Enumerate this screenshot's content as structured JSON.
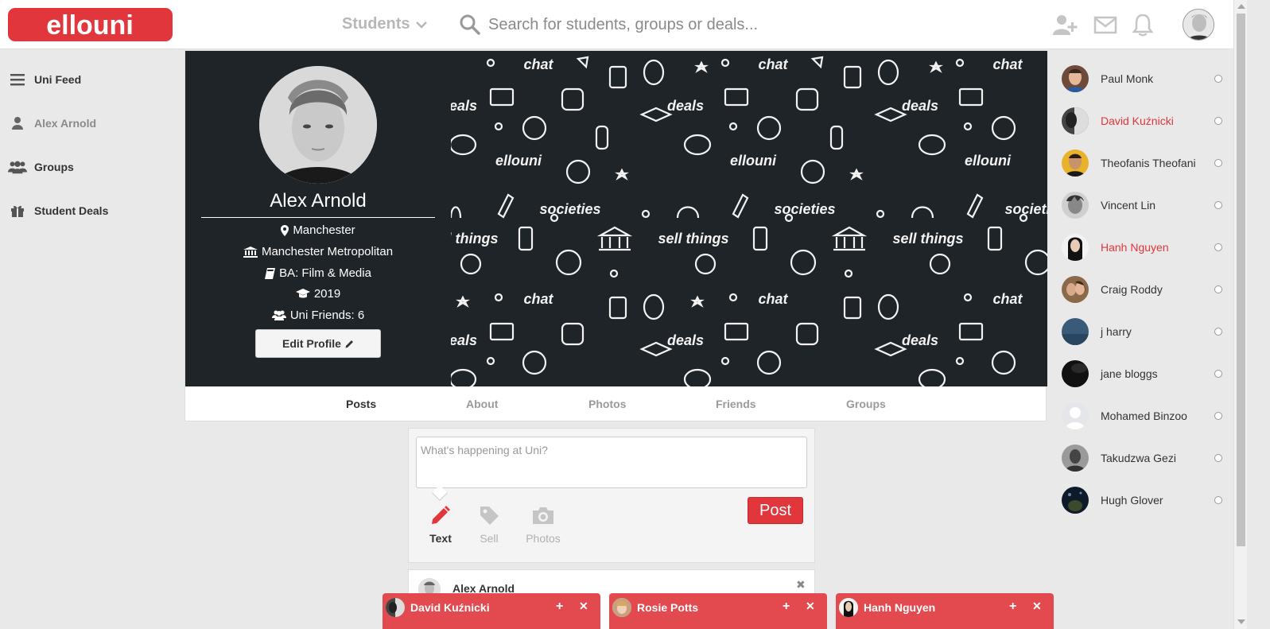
{
  "brand": {
    "accent": "#e0363c",
    "logo_text": "ellouni"
  },
  "topbar": {
    "scope_label": "Students",
    "search_placeholder": "Search for students, groups or deals...",
    "icons": [
      "add-friend-icon",
      "envelope-icon",
      "bell-icon"
    ]
  },
  "leftnav": {
    "items": [
      {
        "label": "Uni Feed",
        "icon": "bars-icon"
      },
      {
        "label": "Alex Arnold",
        "icon": "user-icon"
      },
      {
        "label": "Groups",
        "icon": "users-icon"
      },
      {
        "label": "Student Deals",
        "icon": "gift-icon"
      }
    ]
  },
  "profile": {
    "name": "Alex Arnold",
    "city": "Manchester",
    "university": "Manchester Metropolitan",
    "course": "BA: Film & Media",
    "year": "2019",
    "friends": "Uni Friends: 6",
    "edit_label": "Edit Profile"
  },
  "cover": {
    "words": [
      "chat",
      "deals",
      "societies",
      "sell things",
      "ellouni"
    ]
  },
  "tabs": [
    "Posts",
    "About",
    "Photos",
    "Friends",
    "Groups"
  ],
  "composer": {
    "placeholder": "What's happening at Uni?",
    "types": [
      "Text",
      "Sell",
      "Photos"
    ],
    "post_label": "Post"
  },
  "post": {
    "author": "Alex Arnold",
    "close": "✖"
  },
  "friends": [
    {
      "name": "Paul Monk",
      "highlight": false
    },
    {
      "name": "David Kuźnicki",
      "highlight": true
    },
    {
      "name": "Theofanis Theofani",
      "highlight": false
    },
    {
      "name": "Vincent Lin",
      "highlight": false
    },
    {
      "name": "Hanh Nguyen",
      "highlight": true
    },
    {
      "name": "Craig Roddy",
      "highlight": false
    },
    {
      "name": "j harry",
      "highlight": false
    },
    {
      "name": "jane bloggs",
      "highlight": false
    },
    {
      "name": "Mohamed Binzoo",
      "highlight": false
    },
    {
      "name": "Takudzwa Gezi",
      "highlight": false
    },
    {
      "name": "Hugh Glover",
      "highlight": false
    }
  ],
  "chats": [
    {
      "name": "David Kuźnicki",
      "plus": "+",
      "close": "✕"
    },
    {
      "name": "Rosie Potts",
      "plus": "+",
      "close": "✕"
    },
    {
      "name": "Hanh Nguyen",
      "plus": "+",
      "close": "✕"
    }
  ]
}
